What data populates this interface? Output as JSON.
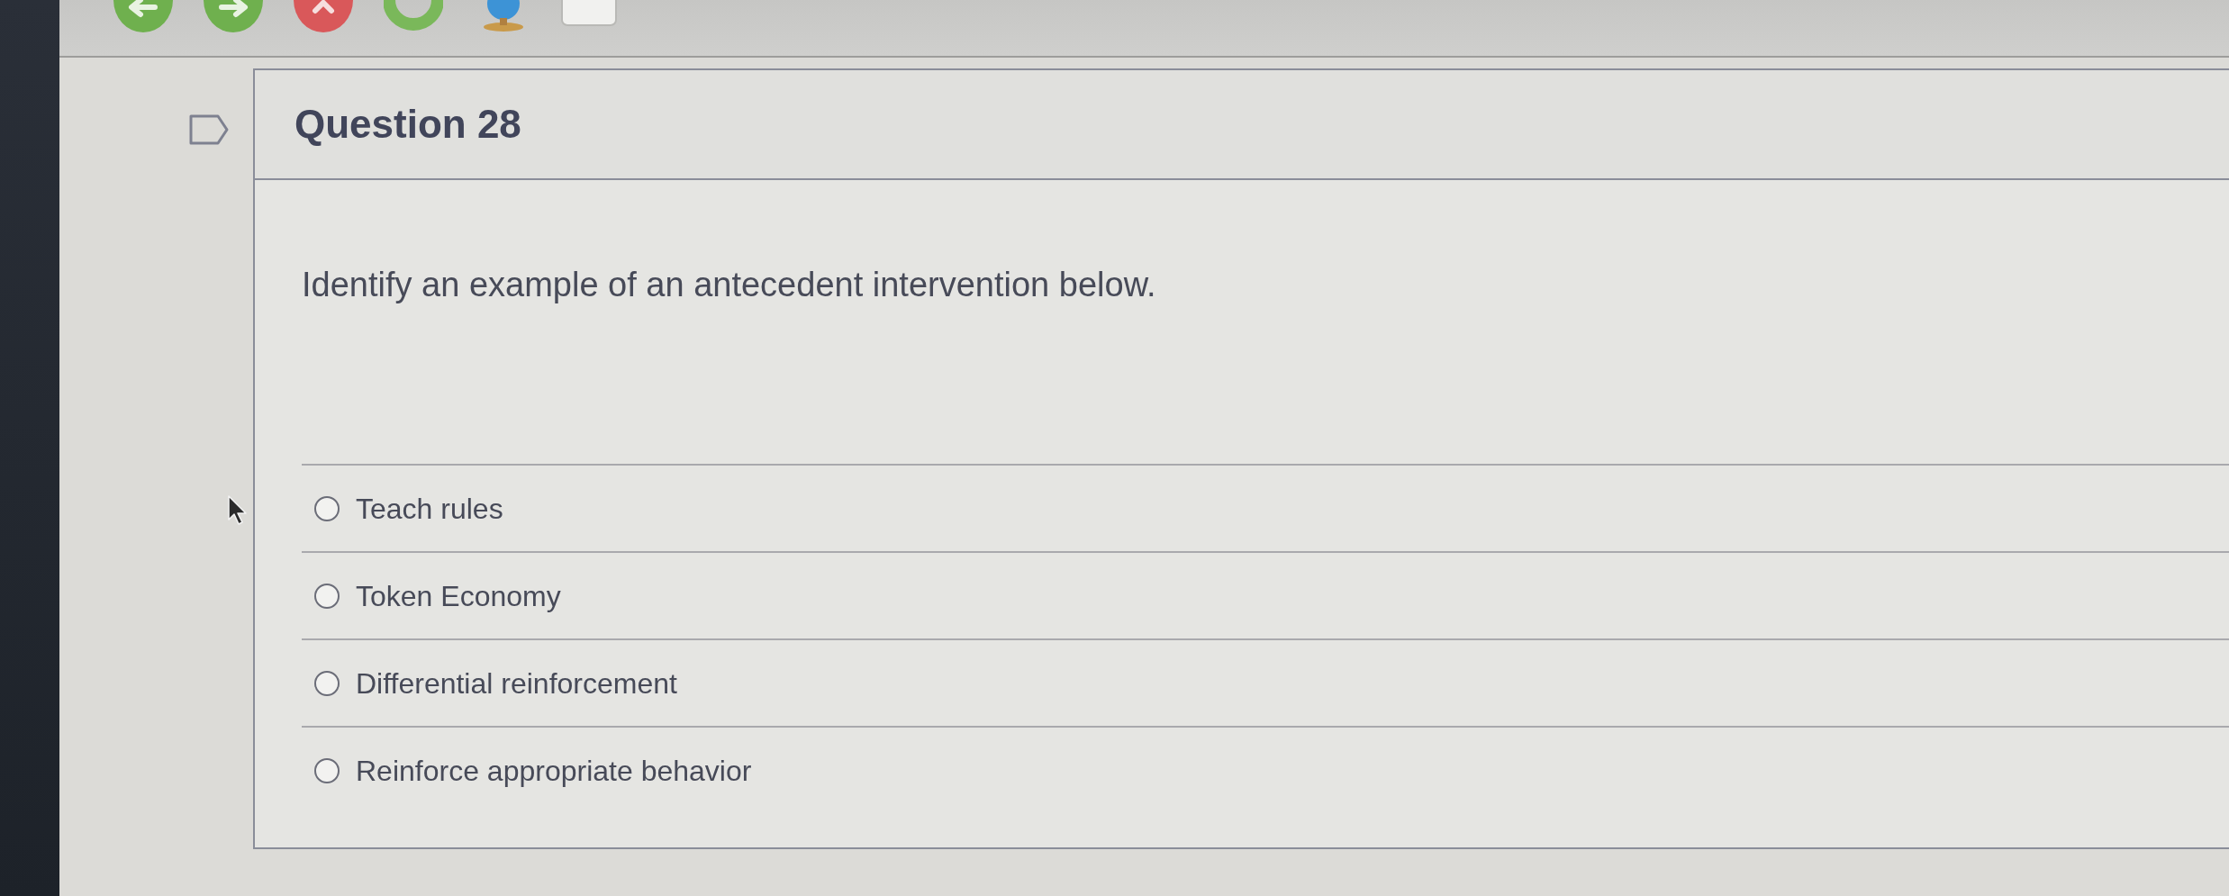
{
  "question": {
    "flagged": false,
    "title": "Question 28",
    "text": "Identify an example of an antecedent intervention below.",
    "options": [
      {
        "label": "Teach rules",
        "selected": false
      },
      {
        "label": "Token Economy",
        "selected": false
      },
      {
        "label": "Differential reinforcement",
        "selected": false
      },
      {
        "label": "Reinforce appropriate behavior",
        "selected": false
      }
    ]
  }
}
